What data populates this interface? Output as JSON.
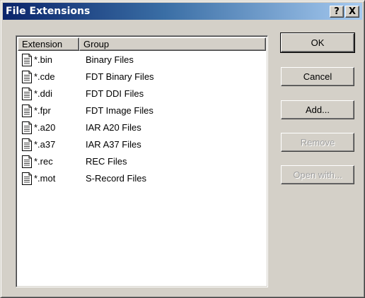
{
  "window": {
    "title": "File Extensions",
    "help_glyph": "?",
    "close_glyph": "X"
  },
  "list": {
    "columns": [
      "Extension",
      "Group"
    ],
    "rows": [
      {
        "extension": "*.bin",
        "group": "Binary Files",
        "icon": "document-icon"
      },
      {
        "extension": "*.cde",
        "group": "FDT Binary Files",
        "icon": "document-icon"
      },
      {
        "extension": "*.ddi",
        "group": "FDT DDI Files",
        "icon": "document-icon"
      },
      {
        "extension": "*.fpr",
        "group": "FDT Image Files",
        "icon": "document-icon"
      },
      {
        "extension": "*.a20",
        "group": "IAR A20 Files",
        "icon": "document-icon"
      },
      {
        "extension": "*.a37",
        "group": "IAR A37 Files",
        "icon": "document-icon"
      },
      {
        "extension": "*.rec",
        "group": "REC Files",
        "icon": "document-icon"
      },
      {
        "extension": "*.mot",
        "group": "S-Record Files",
        "icon": "document-icon"
      }
    ]
  },
  "buttons": {
    "ok": {
      "label": "OK",
      "enabled": true
    },
    "cancel": {
      "label": "Cancel",
      "enabled": true
    },
    "add": {
      "label": "Add...",
      "enabled": true
    },
    "remove": {
      "label": "Remove",
      "enabled": false
    },
    "open_with": {
      "label": "Open with...",
      "enabled": false
    }
  }
}
